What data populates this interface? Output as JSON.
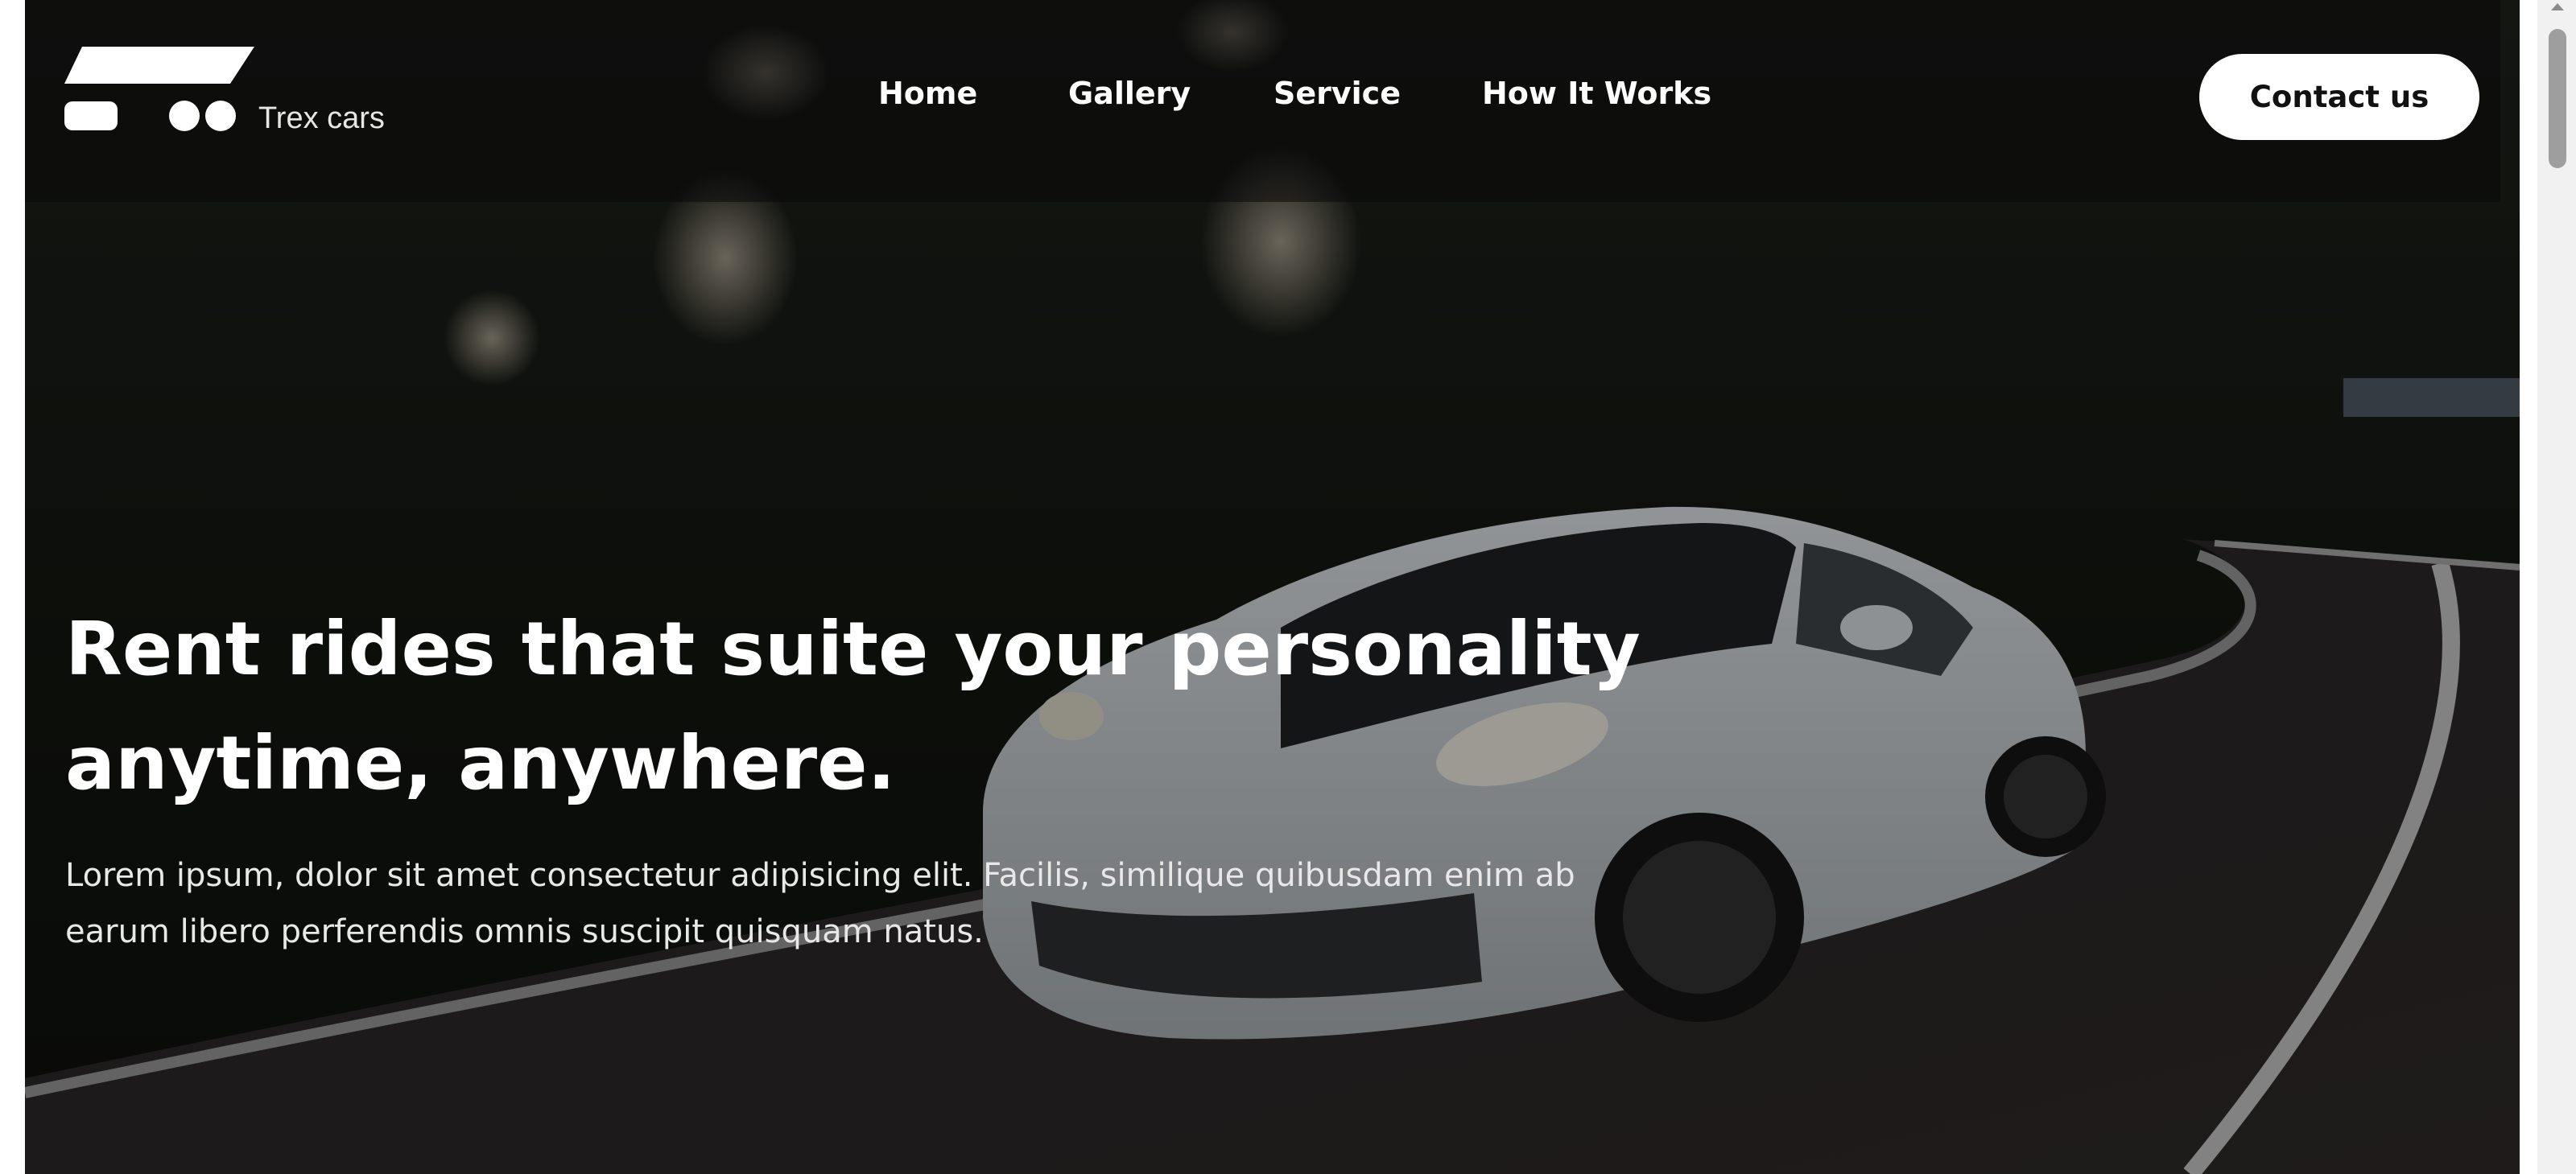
{
  "brand": {
    "name": "Trex cars",
    "logo_icon": "car-wheels-logo-icon"
  },
  "nav": {
    "items": [
      {
        "label": "Home"
      },
      {
        "label": "Gallery"
      },
      {
        "label": "Service"
      },
      {
        "label": "How It Works"
      }
    ],
    "contact_label": "Contact us"
  },
  "hero": {
    "headline_line1": "Rent rides that suite your personality",
    "headline_line2": "anytime, anywhere.",
    "description_line1": "Lorem ipsum, dolor sit amet consectetur adipisicing elit. Facilis, similique quibusdam enim ab",
    "description_line2": "earum libero perferendis omnis suscipit quisquam natus."
  },
  "colors": {
    "navbar_overlay": "#0a0a0a",
    "button_bg": "#ffffff",
    "button_text": "#111111",
    "text_primary": "#ffffff"
  }
}
